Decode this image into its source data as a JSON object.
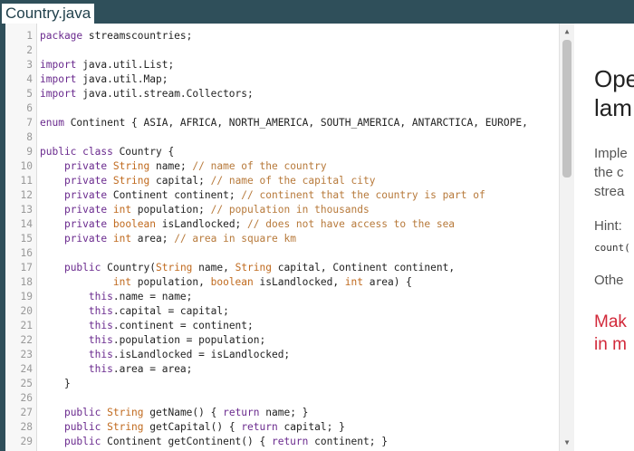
{
  "window": {
    "tab_title": "Country.java"
  },
  "editor": {
    "lines": [
      {
        "n": "1",
        "segs": [
          [
            "kw",
            "package "
          ],
          [
            "",
            "streamscountries;"
          ]
        ]
      },
      {
        "n": "2",
        "segs": []
      },
      {
        "n": "3",
        "segs": [
          [
            "kw",
            "import "
          ],
          [
            "",
            "java.util.List;"
          ]
        ]
      },
      {
        "n": "4",
        "segs": [
          [
            "kw",
            "import "
          ],
          [
            "",
            "java.util.Map;"
          ]
        ]
      },
      {
        "n": "5",
        "segs": [
          [
            "kw",
            "import "
          ],
          [
            "",
            "java.util.stream.Collectors;"
          ]
        ]
      },
      {
        "n": "6",
        "segs": []
      },
      {
        "n": "7",
        "segs": [
          [
            "kw",
            "enum "
          ],
          [
            "",
            "Continent { ASIA, AFRICA, NORTH_AMERICA, SOUTH_AMERICA, ANTARCTICA, EUROPE,"
          ]
        ]
      },
      {
        "n": "8",
        "segs": []
      },
      {
        "n": "9",
        "segs": [
          [
            "kw",
            "public class "
          ],
          [
            "",
            "Country {"
          ]
        ]
      },
      {
        "n": "10",
        "segs": [
          [
            "",
            "    "
          ],
          [
            "kw",
            "private "
          ],
          [
            "ty",
            "String "
          ],
          [
            "",
            "name; "
          ],
          [
            "cm",
            "// name of the country"
          ]
        ]
      },
      {
        "n": "11",
        "segs": [
          [
            "",
            "    "
          ],
          [
            "kw",
            "private "
          ],
          [
            "ty",
            "String "
          ],
          [
            "",
            "capital; "
          ],
          [
            "cm",
            "// name of the capital city"
          ]
        ]
      },
      {
        "n": "12",
        "segs": [
          [
            "",
            "    "
          ],
          [
            "kw",
            "private "
          ],
          [
            "",
            "Continent continent; "
          ],
          [
            "cm",
            "// continent that the country is part of"
          ]
        ]
      },
      {
        "n": "13",
        "segs": [
          [
            "",
            "    "
          ],
          [
            "kw",
            "private "
          ],
          [
            "ty",
            "int "
          ],
          [
            "",
            "population; "
          ],
          [
            "cm",
            "// population in thousands"
          ]
        ]
      },
      {
        "n": "14",
        "segs": [
          [
            "",
            "    "
          ],
          [
            "kw",
            "private "
          ],
          [
            "ty",
            "boolean "
          ],
          [
            "",
            "isLandlocked; "
          ],
          [
            "cm",
            "// does not have access to the sea"
          ]
        ]
      },
      {
        "n": "15",
        "segs": [
          [
            "",
            "    "
          ],
          [
            "kw",
            "private "
          ],
          [
            "ty",
            "int "
          ],
          [
            "",
            "area; "
          ],
          [
            "cm",
            "// area in square km"
          ]
        ]
      },
      {
        "n": "16",
        "segs": []
      },
      {
        "n": "17",
        "segs": [
          [
            "",
            "    "
          ],
          [
            "kw",
            "public "
          ],
          [
            "",
            "Country("
          ],
          [
            "ty",
            "String "
          ],
          [
            "",
            "name, "
          ],
          [
            "ty",
            "String "
          ],
          [
            "",
            "capital, Continent continent,"
          ]
        ]
      },
      {
        "n": "18",
        "segs": [
          [
            "",
            "            "
          ],
          [
            "ty",
            "int "
          ],
          [
            "",
            "population, "
          ],
          [
            "ty",
            "boolean "
          ],
          [
            "",
            "isLandlocked, "
          ],
          [
            "ty",
            "int "
          ],
          [
            "",
            "area) {"
          ]
        ]
      },
      {
        "n": "19",
        "segs": [
          [
            "",
            "        "
          ],
          [
            "kw",
            "this"
          ],
          [
            "",
            ".name = name;"
          ]
        ]
      },
      {
        "n": "20",
        "segs": [
          [
            "",
            "        "
          ],
          [
            "kw",
            "this"
          ],
          [
            "",
            ".capital = capital;"
          ]
        ]
      },
      {
        "n": "21",
        "segs": [
          [
            "",
            "        "
          ],
          [
            "kw",
            "this"
          ],
          [
            "",
            ".continent = continent;"
          ]
        ]
      },
      {
        "n": "22",
        "segs": [
          [
            "",
            "        "
          ],
          [
            "kw",
            "this"
          ],
          [
            "",
            ".population = population;"
          ]
        ]
      },
      {
        "n": "23",
        "segs": [
          [
            "",
            "        "
          ],
          [
            "kw",
            "this"
          ],
          [
            "",
            ".isLandlocked = isLandlocked;"
          ]
        ]
      },
      {
        "n": "24",
        "segs": [
          [
            "",
            "        "
          ],
          [
            "kw",
            "this"
          ],
          [
            "",
            ".area = area;"
          ]
        ]
      },
      {
        "n": "25",
        "segs": [
          [
            "",
            "    }"
          ]
        ]
      },
      {
        "n": "26",
        "segs": []
      },
      {
        "n": "27",
        "segs": [
          [
            "",
            "    "
          ],
          [
            "kw",
            "public "
          ],
          [
            "ty",
            "String "
          ],
          [
            "",
            "getName() { "
          ],
          [
            "kw",
            "return "
          ],
          [
            "",
            "name; }"
          ]
        ]
      },
      {
        "n": "28",
        "segs": [
          [
            "",
            "    "
          ],
          [
            "kw",
            "public "
          ],
          [
            "ty",
            "String "
          ],
          [
            "",
            "getCapital() { "
          ],
          [
            "kw",
            "return "
          ],
          [
            "",
            "capital; }"
          ]
        ]
      },
      {
        "n": "29",
        "segs": [
          [
            "",
            "    "
          ],
          [
            "kw",
            "public "
          ],
          [
            "",
            "Continent getContinent() { "
          ],
          [
            "kw",
            "return "
          ],
          [
            "",
            "continent; }"
          ]
        ]
      }
    ],
    "scroll_up_icon": "triangle-up-icon",
    "scroll_down_icon": "triangle-down-icon"
  },
  "instructions": {
    "heading_line1": "Ope",
    "heading_line2": "lam",
    "body_line1": "Imple",
    "body_line2": "the c",
    "body_line3": "strea",
    "hint_label": "Hint:",
    "hint_code": "count(",
    "other": "Othe",
    "red_line1": "Mak",
    "red_line2": "in m"
  },
  "colors": {
    "chrome": "#2f4f5a",
    "keyword": "#6a2a8e",
    "type": "#c06a1e",
    "comment": "#b7793a",
    "emphasis": "#d2293a"
  }
}
